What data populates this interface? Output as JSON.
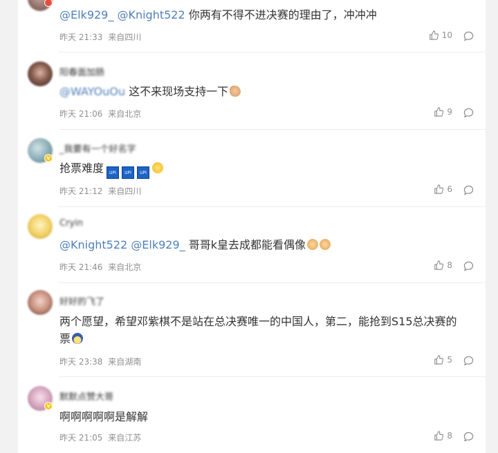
{
  "comments": [
    {
      "username": "",
      "mentions": [
        "@Elk929_",
        "@Knight522"
      ],
      "text": "你两有不得不进决赛的理由了，冲冲冲",
      "time": "昨天 21:33",
      "location": "来自四川",
      "likes": "10"
    },
    {
      "username": "阳春面加肠",
      "mentions": [
        "@WAYOuOu"
      ],
      "text": "这不来现场支持一下",
      "time": "昨天 21:06",
      "location": "来自北京",
      "likes": "9"
    },
    {
      "username": "_我要有一个好名字",
      "mentions": [],
      "text": "抢票难度",
      "emoji_label": "UPI",
      "time": "昨天 21:12",
      "location": "来自四川",
      "likes": "6"
    },
    {
      "username": "Cryin",
      "mentions": [
        "@Knight522",
        "@Elk929_"
      ],
      "text": "哥哥k皇去成都能看偶像",
      "time": "昨天 21:46",
      "location": "来自北京",
      "likes": "8"
    },
    {
      "username": "好好的飞了",
      "mentions": [],
      "text": "两个愿望，希望邓紫棋不是站在总决赛唯一的中国人，第二，能抢到S15总决赛的票",
      "time": "昨天 23:38",
      "location": "来自湖南",
      "likes": "5"
    },
    {
      "username": "默默点赞大哥",
      "mentions": [],
      "text": "啊啊啊啊啊是解解",
      "time": "昨天 21:05",
      "location": "来自江苏",
      "likes": "8"
    }
  ],
  "icons": {
    "like": "thumbs-up-icon",
    "reply": "comment-bubble-icon",
    "verified": "verified-badge-icon"
  },
  "colors": {
    "mention": "#4f7fb8",
    "meta": "#8f8f8f",
    "verified": "#ffc21a"
  }
}
